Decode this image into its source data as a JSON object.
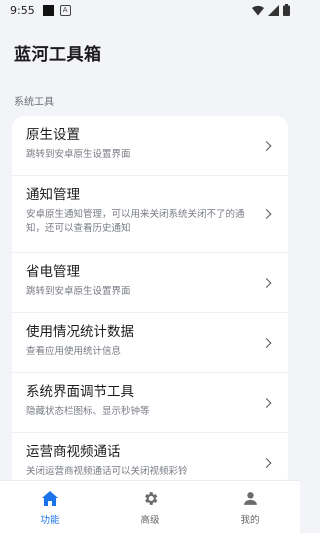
{
  "status_bar": {
    "time": "9:55"
  },
  "app": {
    "title": "蓝河工具箱"
  },
  "section": {
    "label": "系统工具"
  },
  "items": [
    {
      "title": "原生设置",
      "desc": "跳转到安卓原生设置界面"
    },
    {
      "title": "通知管理",
      "desc": "安卓原生通知管理，可以用来关闭系统关闭不了的通知，还可以查看历史通知"
    },
    {
      "title": "省电管理",
      "desc": "跳转到安卓原生设置界面"
    },
    {
      "title": "使用情况统计数据",
      "desc": "查看应用使用统计信息"
    },
    {
      "title": "系统界面调节工具",
      "desc": "隐藏状态栏图标、显示秒钟等"
    },
    {
      "title": "运营商视频通话",
      "desc": "关闭运营商视频通话可以关闭视频彩铃"
    }
  ],
  "nav": {
    "items": [
      {
        "label": "功能",
        "icon": "home-icon",
        "active": true
      },
      {
        "label": "高级",
        "icon": "gear-icon",
        "active": false
      },
      {
        "label": "我的",
        "icon": "person-icon",
        "active": false
      }
    ]
  },
  "colors": {
    "accent": "#1a73e8",
    "background": "#f3f4f8",
    "card": "#ffffff"
  }
}
